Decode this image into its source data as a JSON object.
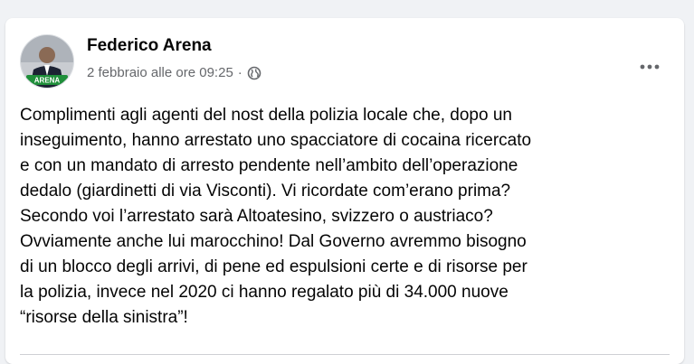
{
  "post": {
    "author_name": "Federico Arena",
    "timestamp": "2 febbraio alle ore 09:25",
    "separator": "·",
    "audience_icon": "globe-icon",
    "more_icon": "more-options-icon",
    "avatar_badge_text": "ARENA",
    "body": "Complimenti agli agenti del nost della polizia locale che, dopo un\ninseguimento, hanno arrestato uno spacciatore di cocaina ricercato\ne con un mandato di arresto pendente nell’ambito dell’operazione\ndedalo (giardinetti di via Visconti). Vi ricordate com’erano prima?\nSecondo voi l’arrestato sarà Altoatesino, svizzero o austriaco?\nOvviamente anche lui marocchino! Dal Governo avremmo bisogno\ndi un blocco degli arrivi, di pene ed espulsioni certe e di risorse per\nla polizia, invece nel 2020 ci hanno regalato più di 34.000 nuove\n“risorse della sinistra”!"
  },
  "colors": {
    "page_background": "#f0f2f5",
    "card_background": "#ffffff",
    "primary_text": "#050505",
    "secondary_text": "#65676b",
    "avatar_badge": "#1f8f3a"
  }
}
